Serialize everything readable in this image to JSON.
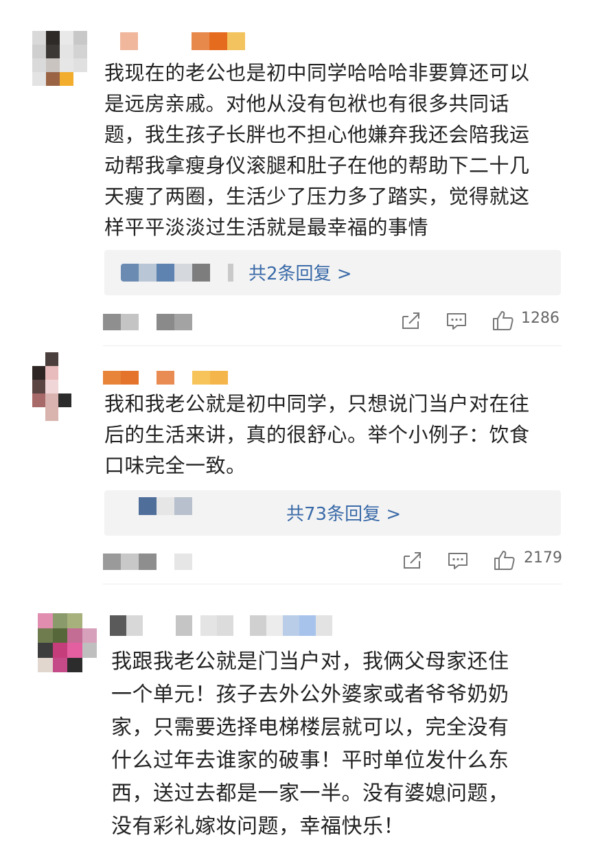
{
  "colors": {
    "reply_link": "#3a6aa8",
    "reply_bg": "#f3f3f3",
    "icon_gray": "#777777",
    "text": "#222222"
  },
  "comments": [
    {
      "body_lines": [
        "我现在的老公也是初中同学哈哈哈非要算还可以",
        "是远房亲戚。对他从没有包袱也有很多共同话",
        "题，我生孩子长胖也不担心他嫌弃我还会陪我运",
        "动帮我拿瘦身仪滚腿和肚子在他的帮助下二十几",
        "天瘦了两圈，生活少了压力多了踏实，觉得就这",
        "样平平淡淡过生活就是最幸福的事情"
      ],
      "reply_text": "共2条回复 >",
      "likes": "1286",
      "icons": [
        "share-icon",
        "comment-icon",
        "like-icon"
      ]
    },
    {
      "body_lines": [
        "我和我老公就是初中同学，只想说门当户对在往",
        "后的生活来讲，真的很舒心。举个小例子：饮食",
        "口味完全一致。"
      ],
      "reply_text": "共73条回复 >",
      "likes": "2179",
      "icons": [
        "share-icon",
        "comment-icon",
        "like-icon"
      ]
    },
    {
      "body_lines": [
        "我跟我老公就是门当户对，我俩父母家还住",
        "一个单元！孩子去外公外婆家或者爷爷奶奶",
        "家，只需要选择电梯楼层就可以，完全没有",
        "什么过年去谁家的破事！平时单位发什么东",
        "西，送过去都是一家一半。没有婆媳问题，",
        "没有彩礼嫁妆问题，幸福快乐！"
      ]
    }
  ]
}
